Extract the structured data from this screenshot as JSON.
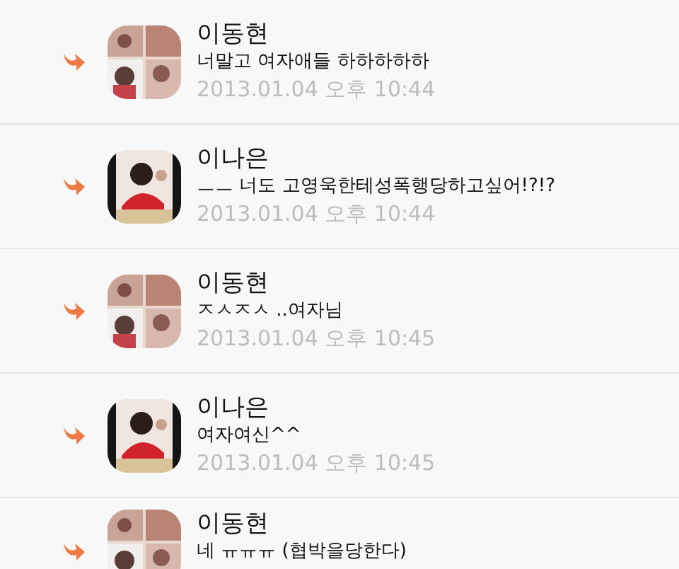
{
  "messages": [
    {
      "name": "이동현",
      "text": "너말고 여자애들 하하하하하",
      "time": "2013.01.04 오후 10:44"
    },
    {
      "name": "이나은",
      "text": "ㅡㅡ 너도 고영욱한테성폭행당하고싶어!?!?",
      "time": "2013.01.04 오후 10:44"
    },
    {
      "name": "이동현",
      "text": "ㅈㅅㅈㅅ ..여자님",
      "time": "2013.01.04 오후 10:45"
    },
    {
      "name": "이나은",
      "text": "여자여신^^",
      "time": "2013.01.04 오후 10:45"
    },
    {
      "name": "이동현",
      "text": "네 ㅠㅠㅠ (협박을당한다)"
    }
  ]
}
